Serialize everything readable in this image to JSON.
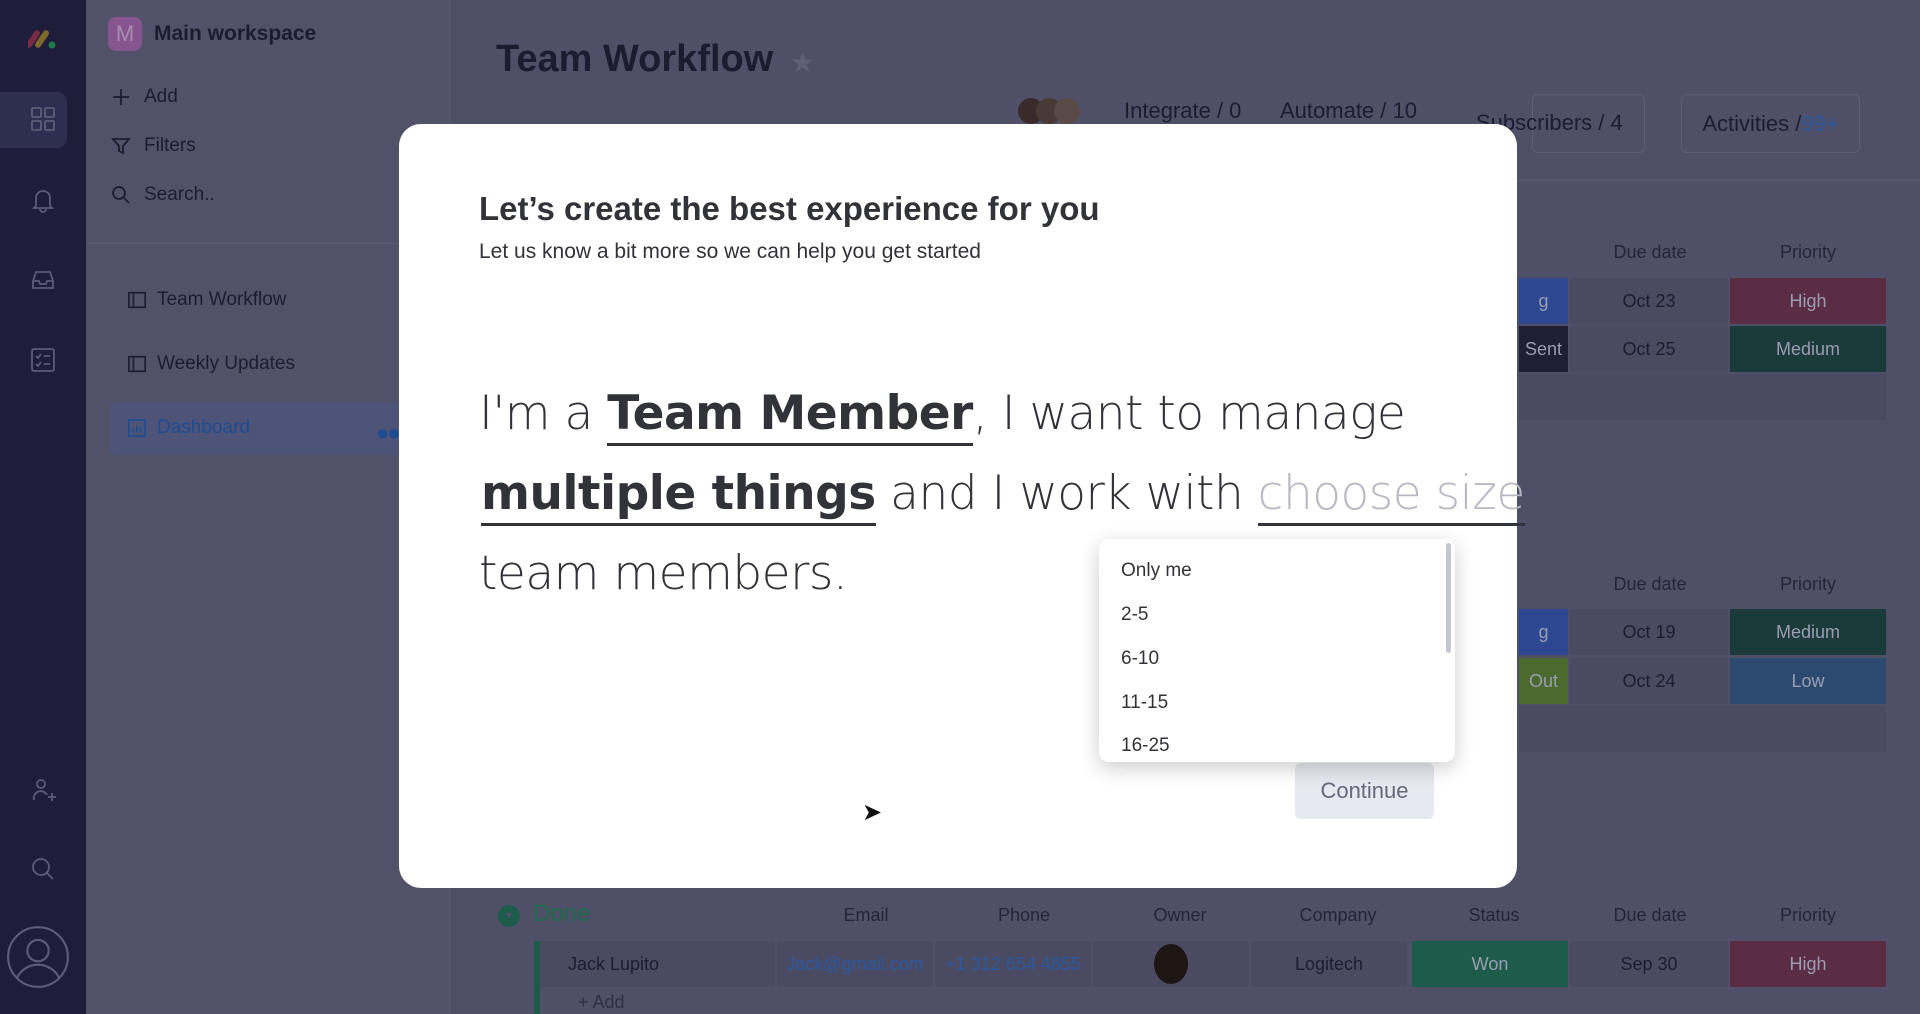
{
  "sidebar": {
    "workspace_initial": "M",
    "workspace_name": "Main workspace",
    "actions": [
      "Add",
      "Filters",
      "Search.."
    ],
    "boards": [
      "Team Workflow",
      "Weekly Updates",
      "Dashboard"
    ]
  },
  "board": {
    "title": "Team Workflow",
    "integrate": "Integrate / 0",
    "automate": "Automate / 10",
    "subscribers": "Subscribers / 4",
    "activities_label": "Activities /",
    "activities_count": "99+",
    "columns": [
      "Email",
      "Phone",
      "Owner",
      "Company",
      "Status",
      "Due date",
      "Priority"
    ],
    "group1": {
      "rows": [
        {
          "status": "g",
          "due": "Oct 23",
          "priority": "High"
        },
        {
          "status": "Sent",
          "due": "Oct 25",
          "priority": "Medium"
        }
      ]
    },
    "group2": {
      "rows": [
        {
          "status": "g",
          "due": "Oct 19",
          "priority": "Medium"
        },
        {
          "status": "Out",
          "due": "Oct 24",
          "priority": "Low"
        }
      ]
    },
    "done": {
      "name": "Done",
      "row": {
        "name": "Jack Lupito",
        "email": "Jack@gmail.com",
        "phone": "+1 312 654 4855",
        "company": "Logitech",
        "status": "Won",
        "due": "Sep 30",
        "priority": "High"
      },
      "add": "+ Add"
    },
    "colors": {
      "high": "#e2445c",
      "medium": "#037f4c",
      "low": "#579bfc",
      "working": "#3c6fd9",
      "sent": "#1f1f3a",
      "out": "#9cd326",
      "won": "#00c875"
    }
  },
  "modal": {
    "title": "Let’s create the best experience for you",
    "subtitle": "Let us know a bit more so we can help you get started",
    "s1": "I'm a ",
    "role": "Team Member",
    "s2": ", I want to manage",
    "scope": "multiple things",
    "s3": " and I work with ",
    "size_placeholder": "choose size",
    "s4": "team members.",
    "size_options": [
      "Only me",
      "2-5",
      "6-10",
      "11-15",
      "16-25"
    ],
    "continue": "Continue"
  }
}
